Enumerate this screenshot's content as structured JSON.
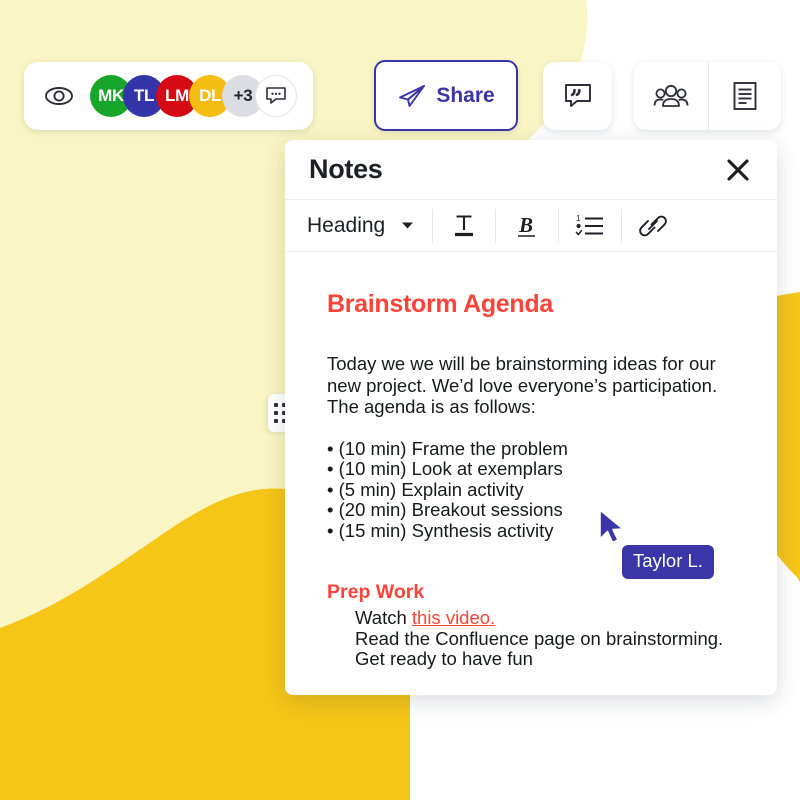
{
  "background": {
    "pale_yellow": "#f9f5c4",
    "golden_yellow": "#f5c518",
    "page_white": "#ffffff"
  },
  "presence_bar": {
    "visibility_icon": "eye-icon",
    "avatars": [
      {
        "initials": "MK",
        "color": "#17a52a",
        "text_color": "#ffffff"
      },
      {
        "initials": "TL",
        "color": "#3333aa",
        "text_color": "#ffffff"
      },
      {
        "initials": "LM",
        "color": "#d50a14",
        "text_color": "#ffffff"
      },
      {
        "initials": "DL",
        "color": "#f5bc11",
        "text_color": "#ffffff"
      }
    ],
    "overflow_count": "+3",
    "comment_avatar_icon": "chat-bubble-icon"
  },
  "toolbar": {
    "share_label": "Share",
    "share_icon": "paper-plane-icon",
    "share_accent": "#3a36a8",
    "comment_icon": "quote-bubble-icon",
    "participants_icon": "people-group-icon",
    "notes_icon": "document-icon"
  },
  "notes_panel": {
    "title": "Notes",
    "close_icon": "close-icon",
    "drag_handle_icon": "drag-dots-icon",
    "editor_toolbar": {
      "style_label": "Heading",
      "style_caret_icon": "chevron-down-icon",
      "text_icon": "text-underline-icon",
      "bold_icon": "bold-italic-icon",
      "list_icon": "ordered-list-icon",
      "link_icon": "link-chain-icon"
    },
    "document": {
      "heading": "Brainstorm Agenda",
      "heading_color": "#fb4339",
      "paragraph": "Today we we will be brainstorming ideas for our new project. We’d love everyone’s participation. The agenda is as follows:",
      "agenda_items": [
        "• (10 min) Frame the problem",
        "• (10 min) Look at exemplars",
        "• (5 min) Explain activity",
        "• (20 min) Breakout sessions",
        "• (15 min) Synthesis activity"
      ],
      "subheading": "Prep Work",
      "prep_line1_prefix": "Watch ",
      "prep_line1_link": "this video.",
      "prep_line2": "Read the Confluence page on brainstorming.",
      "prep_line3": "Get ready to have fun"
    }
  },
  "remote_cursor": {
    "name": "Taylor L.",
    "color": "#3a36a8",
    "icon": "mouse-pointer-icon"
  }
}
